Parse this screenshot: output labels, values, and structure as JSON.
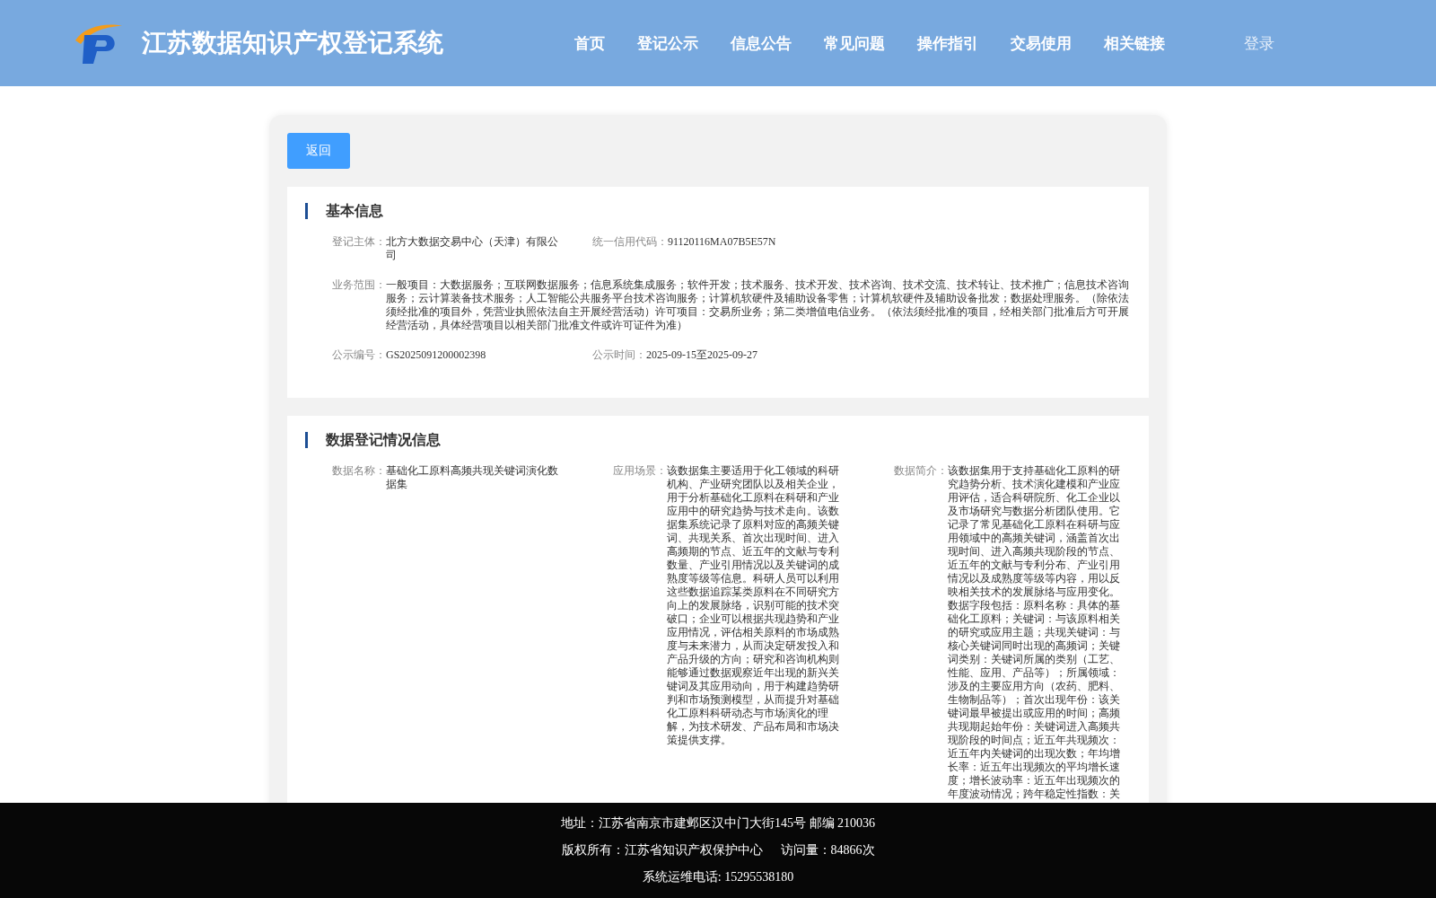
{
  "header": {
    "title": "江苏数据知识产权登记系统",
    "nav": [
      "首页",
      "登记公示",
      "信息公告",
      "常见问题",
      "操作指引",
      "交易使用",
      "相关链接"
    ],
    "login": "登录"
  },
  "back_button": "返回",
  "sections": [
    {
      "title": "基本信息",
      "rows": [
        [
          {
            "label": "登记主体：",
            "value": "北方大数据交易中心（天津）有限公司"
          },
          {
            "label": "统一信用代码：",
            "value": "91120116MA07B5E57N"
          }
        ],
        [
          {
            "label": "业务范围：",
            "value": "一般项目：大数据服务；互联网数据服务；信息系统集成服务；软件开发；技术服务、技术开发、技术咨询、技术交流、技术转让、技术推广；信息技术咨询服务；云计算装备技术服务；人工智能公共服务平台技术咨询服务；计算机软硬件及辅助设备零售；计算机软硬件及辅助设备批发；数据处理服务。（除依法须经批准的项目外，凭营业执照依法自主开展经营活动）许可项目：交易所业务；第二类增值电信业务。（依法须经批准的项目，经相关部门批准后方可开展经营活动，具体经营项目以相关部门批准文件或许可证件为准）"
          }
        ],
        [
          {
            "label": "公示编号：",
            "value": "GS2025091200002398"
          },
          {
            "label": "公示时间：",
            "value": "2025-09-15至2025-09-27"
          }
        ]
      ]
    },
    {
      "title": "数据登记情况信息",
      "rows": [
        [
          {
            "label": "数据名称：",
            "value": "基础化工原料高频共现关键词演化数据集"
          },
          {
            "label": "应用场景：",
            "value": "该数据集主要适用于化工领域的科研机构、产业研究团队以及相关企业，用于分析基础化工原料在科研和产业应用中的研究趋势与技术走向。该数据集系统记录了原料对应的高频关键词、共现关系、首次出现时间、进入高频期的节点、近五年的文献与专利数量、产业引用情况以及关键词的成熟度等级等信息。科研人员可以利用这些数据追踪某类原料在不同研究方向上的发展脉络，识别可能的技术突破口；企业可以根据共现趋势和产业应用情况，评估相关原料的市场成熟度与未来潜力，从而决定研发投入和产品升级的方向；研究和咨询机构则能够通过数据观察近年出现的新兴关键词及其应用动向，用于构建趋势研判和市场预测模型，从而提升对基础化工原料科研动态与市场演化的理解，为技术研发、产品布局和市场决策提供支撑。"
          },
          {
            "label": "数据简介：",
            "value": "该数据集用于支持基础化工原料的研究趋势分析、技术演化建模和产业应用评估，适合科研院所、化工企业以及市场研究与数据分析团队使用。它记录了常见基础化工原料在科研与应用领域中的高频关键词，涵盖首次出现时间、进入高频共现阶段的节点、近五年的文献与专利分布、产业引用情况以及成熟度等级等内容，用以反映相关技术的发展脉络与应用变化。数据字段包括：原料名称：具体的基础化工原料；关键词：与该原料相关的研究或应用主题；共现关键词：与核心关键词同时出现的高频词；关键词类别：关键词所属的类别（工艺、性能、应用、产品等）；所属领域：涉及的主要应用方向（农药、肥料、生物制品等）；首次出现年份：该关键词最早被提出或应用的时间；高频共现期起始年份：关键词进入高频共现阶段的时间点；近五年共现频次：近五年内关键词的出现次数；年均增长率：近五年出现频次的平均增长速度；增长波动率：近五年出现频次的年度波动情况；跨年稳定性指数：关"
          }
        ]
      ]
    }
  ],
  "footer": {
    "address": "地址：江苏省南京市建邺区汉中门大街145号 邮编 210036",
    "copyright": "版权所有：江苏省知识产权保护中心",
    "visits": "访问量：84866次",
    "phone": "系统运维电话: 15295538180"
  }
}
